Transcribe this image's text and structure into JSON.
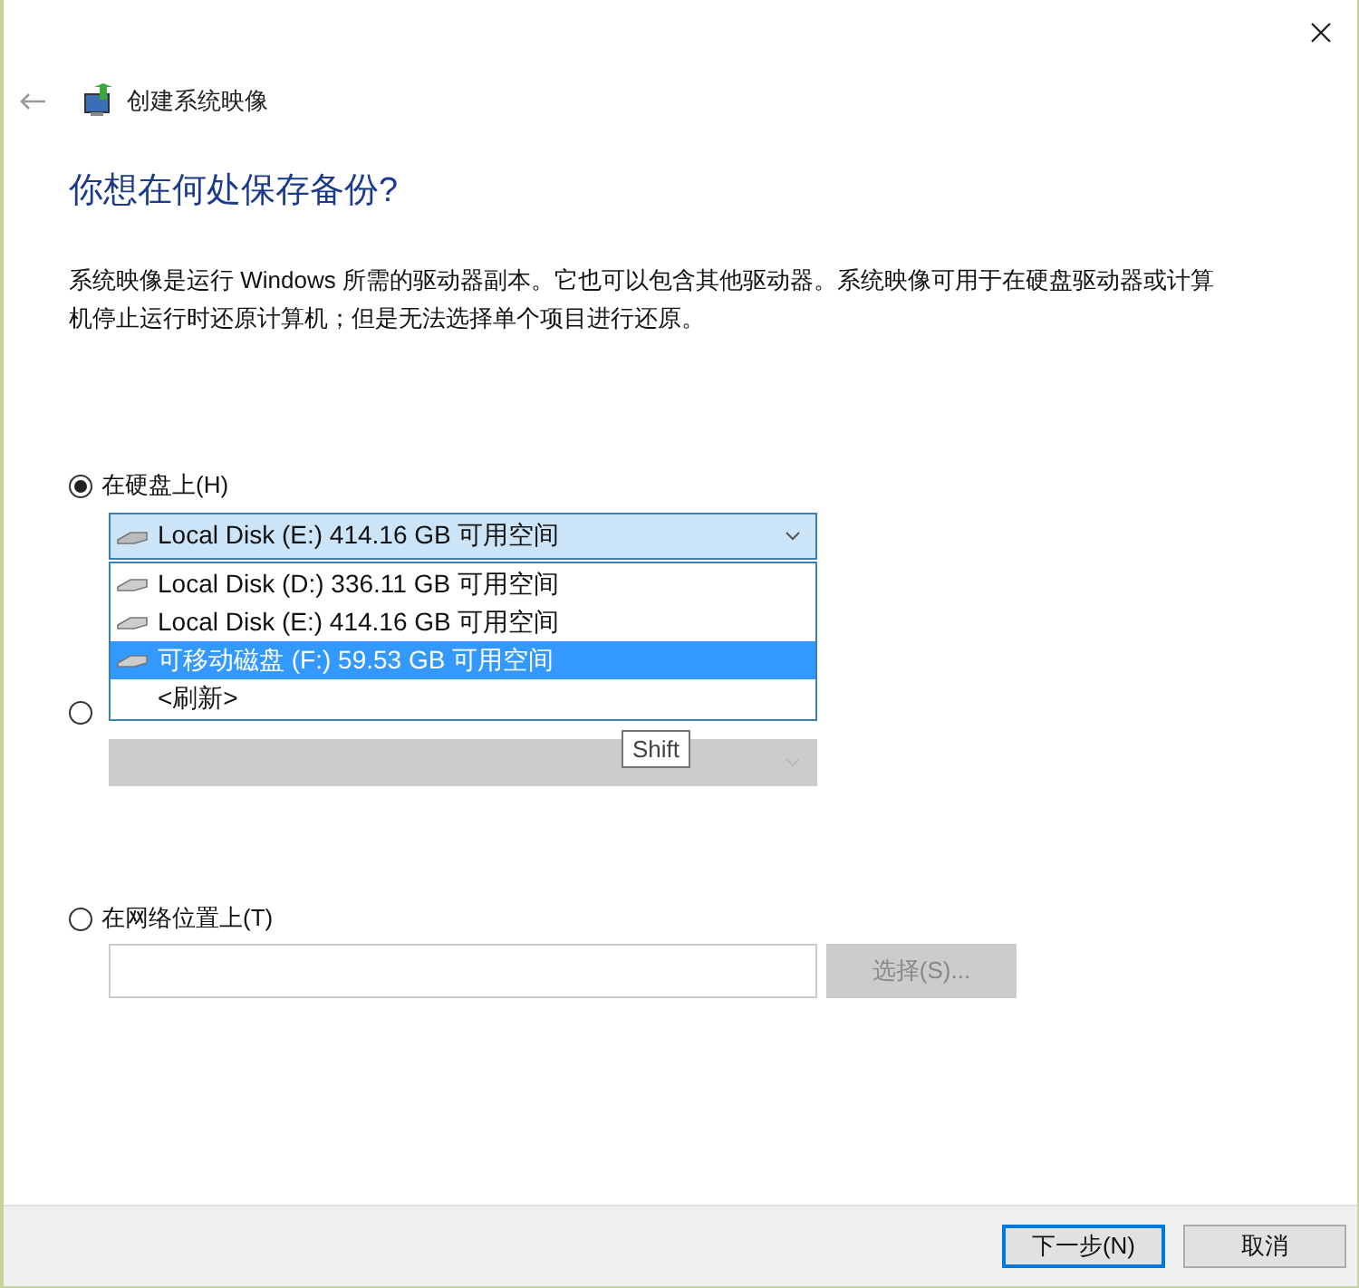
{
  "window": {
    "title": "创建系统映像"
  },
  "heading": "你想在何处保存备份?",
  "description": "系统映像是运行 Windows 所需的驱动器副本。它也可以包含其他驱动器。系统映像可用于在硬盘驱动器或计算机停止运行时还原计算机；但是无法选择单个项目进行还原。",
  "options": [
    {
      "kind": "disk",
      "label": "在硬盘上(H)",
      "selected": true,
      "combo": {
        "value": "Local Disk (E:)  414.16 GB 可用空间",
        "disabled": false,
        "expanded": true,
        "items": [
          {
            "kind": "drive",
            "label": "Local Disk (D:)  336.11 GB 可用空间",
            "highlighted": false
          },
          {
            "kind": "drive",
            "label": "Local Disk (E:)  414.16 GB 可用空间",
            "highlighted": false
          },
          {
            "kind": "drive",
            "label": "可移动磁盘 (F:)  59.53 GB 可用空间",
            "highlighted": true
          },
          {
            "kind": "refresh",
            "label": "<刷新>",
            "highlighted": false
          }
        ]
      }
    },
    {
      "kind": "dvd",
      "selected": false,
      "combo": {
        "disabled": true,
        "expanded": false
      }
    },
    {
      "kind": "network",
      "label": "在网络位置上(T)",
      "selected": false,
      "browse_button": {
        "label": "选择(S)...",
        "disabled": true
      }
    }
  ],
  "tooltip": "Shift",
  "buttons": [
    {
      "label": "下一步(N)",
      "primary": true
    },
    {
      "label": "取消",
      "primary": false
    }
  ]
}
